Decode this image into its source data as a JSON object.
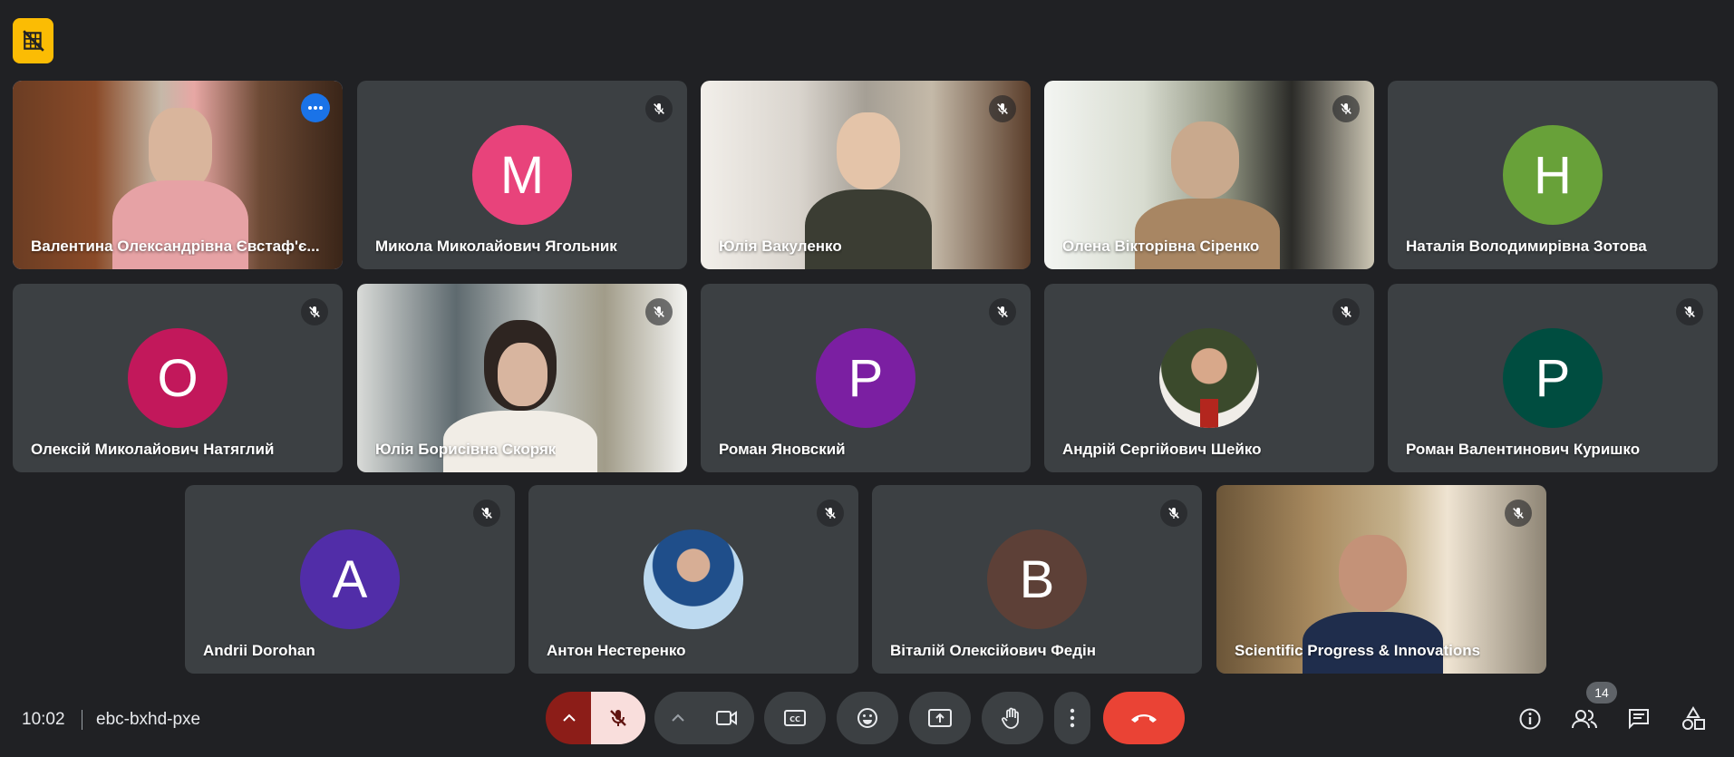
{
  "meeting": {
    "time": "10:02",
    "code": "ebc-bxhd-pxe",
    "participant_count": "14"
  },
  "colors": {
    "background": "#202124",
    "tile": "#3c4043",
    "active_outline": "#8ab4f8",
    "end_call": "#ea4335",
    "mic_muted": "#f9dedc",
    "badge": "#fbbc04"
  },
  "participants": [
    {
      "name": "Валентина Олександрівна Євстаф'є...",
      "type": "video",
      "active": true,
      "muted": false
    },
    {
      "name": "Микола Миколайович Ягольник",
      "type": "avatar",
      "letter": "М",
      "color": "#e8437b",
      "muted": true
    },
    {
      "name": "Юлія Вакуленко",
      "type": "video",
      "muted": true
    },
    {
      "name": "Олена Вікторівна Сіренко",
      "type": "video",
      "muted": true
    },
    {
      "name": "Наталія Володимирівна Зотова",
      "type": "avatar",
      "letter": "Н",
      "color": "#68a139",
      "muted": false
    },
    {
      "name": "Олексій Миколайович Натяглий",
      "type": "avatar",
      "letter": "О",
      "color": "#c2185b",
      "muted": true
    },
    {
      "name": "Юлія Борисівна Скоряк",
      "type": "video",
      "muted": true
    },
    {
      "name": "Роман Яновский",
      "type": "avatar",
      "letter": "Р",
      "color": "#7b1fa2",
      "muted": true
    },
    {
      "name": "Андрій Сергійович Шейко",
      "type": "photo",
      "muted": true
    },
    {
      "name": "Роман Валентинович Куришко",
      "type": "avatar",
      "letter": "Р",
      "color": "#004d40",
      "muted": true
    },
    {
      "name": "Andrii Dorohan",
      "type": "avatar",
      "letter": "A",
      "color": "#512da8",
      "muted": true
    },
    {
      "name": "Антон Нестеренко",
      "type": "photo",
      "muted": true
    },
    {
      "name": "Віталій Олексійович Федін",
      "type": "avatar",
      "letter": "В",
      "color": "#5d4037",
      "muted": true
    },
    {
      "name": "Scientific Progress & Innovations",
      "type": "video",
      "muted": true
    }
  ]
}
